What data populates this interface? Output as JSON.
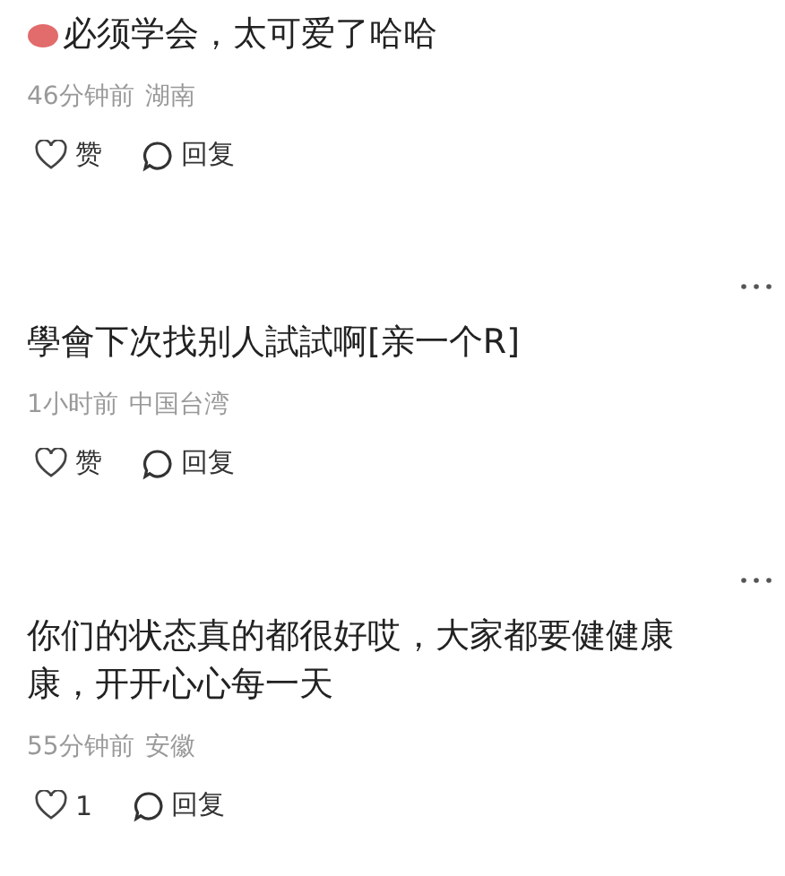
{
  "comments": [
    {
      "has_menu": false,
      "has_emoji": true,
      "text": "必须学会，太可爱了哈哈",
      "time": "46分钟前",
      "location": "湖南",
      "like_label": "赞",
      "reply_label": "回复"
    },
    {
      "has_menu": true,
      "has_emoji": false,
      "text": "學會下次找别人試試啊[亲一个R]",
      "time": "1小时前",
      "location": "中国台湾",
      "like_label": "赞",
      "reply_label": "回复"
    },
    {
      "has_menu": true,
      "has_emoji": false,
      "text": "你们的状态真的都很好哎，大家都要健健康康，开开心心每一天",
      "time": "55分钟前",
      "location": "安徽",
      "like_label": "1",
      "reply_label": "回复"
    }
  ]
}
